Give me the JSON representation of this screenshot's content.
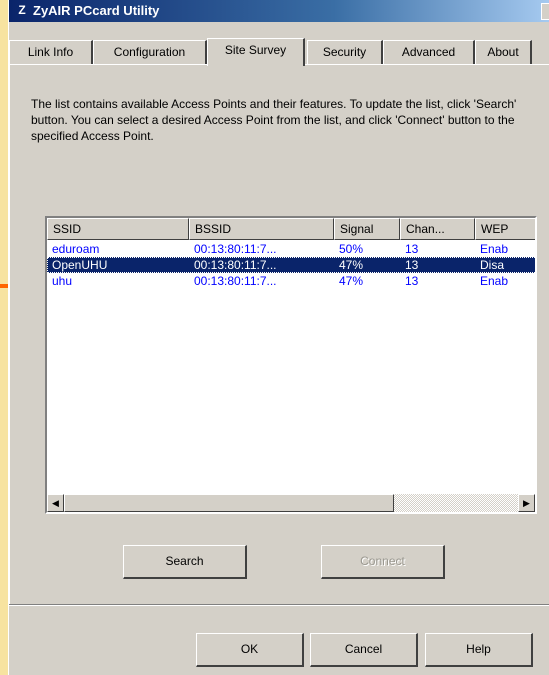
{
  "window": {
    "title": "ZyAIR PCcard Utility",
    "app_icon": "Z"
  },
  "tabs": [
    {
      "label": "Link Info"
    },
    {
      "label": "Configuration"
    },
    {
      "label": "Site Survey",
      "active": true
    },
    {
      "label": "Security"
    },
    {
      "label": "Advanced"
    },
    {
      "label": "About"
    }
  ],
  "site_survey": {
    "description": "The list contains available Access Points and their features. To update the list, click 'Search' button. You can select a desired Access Point from the list, and click 'Connect' button to the specified Access Point.",
    "columns": [
      "SSID",
      "BSSID",
      "Signal",
      "Chan...",
      "WEP"
    ],
    "rows": [
      {
        "ssid": "eduroam",
        "bssid": "00:13:80:11:7...",
        "signal": "50%",
        "channel": "13",
        "wep": "Enab"
      },
      {
        "ssid": "OpenUHU",
        "bssid": "00:13:80:11:7...",
        "signal": "47%",
        "channel": "13",
        "wep": "Disa",
        "selected": true
      },
      {
        "ssid": "uhu",
        "bssid": "00:13:80:11:7...",
        "signal": "47%",
        "channel": "13",
        "wep": "Enab"
      }
    ],
    "search_label": "Search",
    "connect_label": "Connect",
    "connect_enabled": false
  },
  "footer": {
    "ok_label": "OK",
    "cancel_label": "Cancel",
    "help_label": "Help"
  },
  "colors": {
    "background": "#f7e3a0",
    "arrow": "#ff6600",
    "row_text": "#0000ff",
    "selection": "#0a246a"
  }
}
